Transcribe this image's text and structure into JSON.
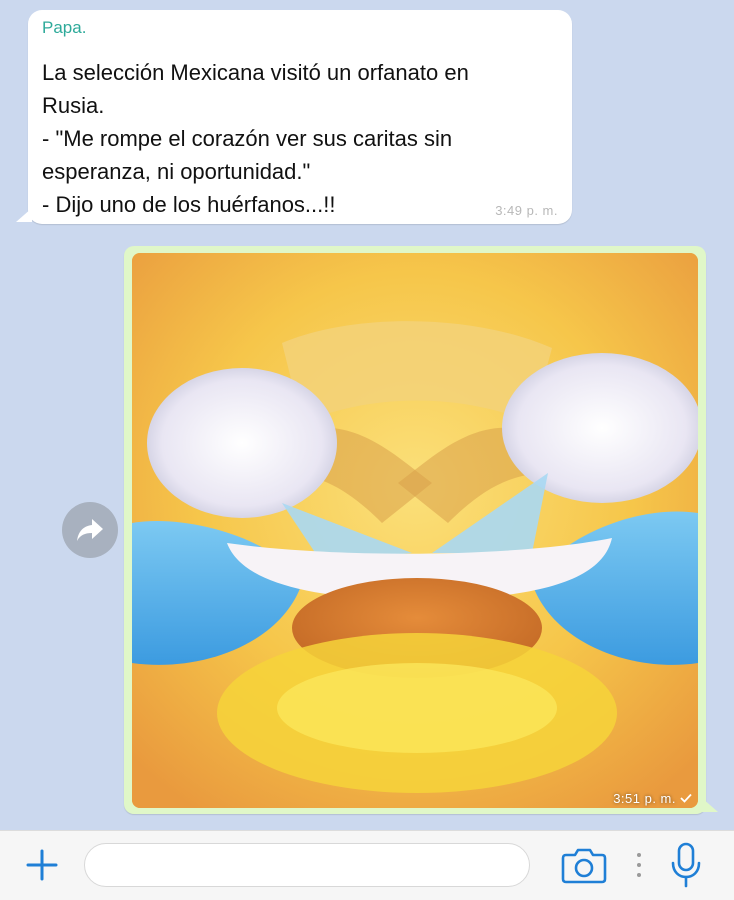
{
  "messages": {
    "incoming": {
      "sender": "Papa.",
      "text": "La selección Mexicana visitó un orfanato en\nRusia.\n- \"Me rompe el corazón ver sus caritas sin\nesperanza, ni oportunidad.\"\n- Dijo uno de los huérfanos...!!",
      "time": "3:49 p. m."
    },
    "outgoing": {
      "image": "laughing-crying-emoji-image",
      "time": "3:51 p. m.",
      "status_icon": "check-icon"
    }
  },
  "composer": {
    "placeholder": "",
    "icons": [
      "plus-icon",
      "camera-icon",
      "mic-icon"
    ]
  },
  "colors": {
    "sender_name": "#2eaa9a",
    "chat_background": "#cbd8ee",
    "outgoing_bubble": "#e0f7c8",
    "accent": "#1f7fd6"
  }
}
